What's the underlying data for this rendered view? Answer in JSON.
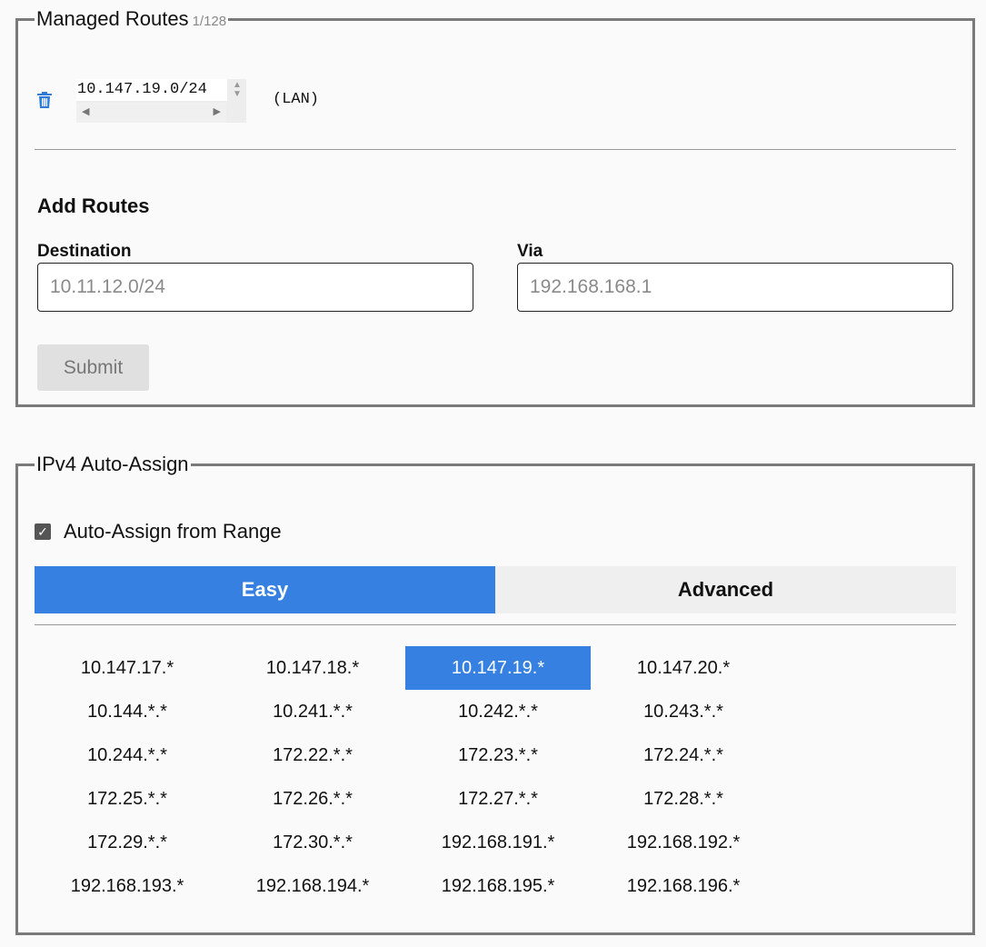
{
  "managed_routes": {
    "title": "Managed Routes",
    "count": "1/128",
    "routes": [
      {
        "destination": "10.147.19.0/24",
        "via": "(LAN)"
      }
    ],
    "icons": {
      "delete": "trash-icon",
      "spin": "spinner-arrows-icon"
    },
    "add_routes": {
      "title": "Add Routes",
      "destination_label": "Destination",
      "destination_placeholder": "10.11.12.0/24",
      "via_label": "Via",
      "via_placeholder": "192.168.168.1",
      "submit_label": "Submit"
    }
  },
  "ipv4_auto_assign": {
    "title": "IPv4 Auto-Assign",
    "checkbox_label": "Auto-Assign from Range",
    "checkbox_checked": true,
    "tabs": [
      {
        "label": "Easy",
        "active": true
      },
      {
        "label": "Advanced",
        "active": false
      }
    ],
    "ranges": [
      "10.147.17.*",
      "10.147.18.*",
      "10.147.19.*",
      "10.147.20.*",
      "10.144.*.*",
      "10.241.*.*",
      "10.242.*.*",
      "10.243.*.*",
      "10.244.*.*",
      "172.22.*.*",
      "172.23.*.*",
      "172.24.*.*",
      "172.25.*.*",
      "172.26.*.*",
      "172.27.*.*",
      "172.28.*.*",
      "172.29.*.*",
      "172.30.*.*",
      "192.168.191.*",
      "192.168.192.*",
      "192.168.193.*",
      "192.168.194.*",
      "192.168.195.*",
      "192.168.196.*"
    ],
    "selected_range": "10.147.19.*"
  },
  "colors": {
    "accent": "#3580e0",
    "trash": "#2f7bd8",
    "border": "#7a7a7a"
  }
}
